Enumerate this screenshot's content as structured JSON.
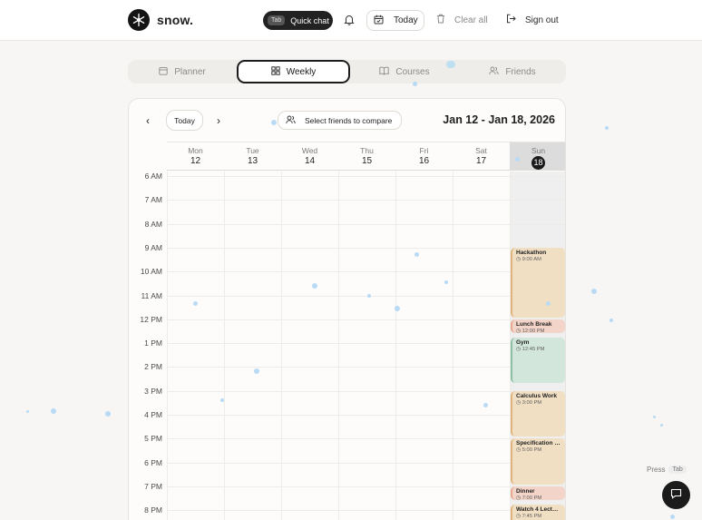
{
  "header": {
    "brand": "snow.",
    "quick_chat": {
      "kbd": "Tab",
      "label": "Quick chat"
    },
    "today_label": "Today",
    "clear_label": "Clear all",
    "signout_label": "Sign out"
  },
  "view_tabs": [
    {
      "label": "Planner",
      "icon": "calendar-icon",
      "active": false
    },
    {
      "label": "Weekly",
      "icon": "grid-icon",
      "active": true
    },
    {
      "label": "Courses",
      "icon": "book-icon",
      "active": false
    },
    {
      "label": "Friends",
      "icon": "users-icon",
      "active": false
    }
  ],
  "calendar": {
    "today_label": "Today",
    "friends_label": "Select friends to compare",
    "date_range": "Jan 12 - Jan 18, 2026",
    "days": [
      {
        "name": "Mon",
        "date": "12"
      },
      {
        "name": "Tue",
        "date": "13"
      },
      {
        "name": "Wed",
        "date": "14"
      },
      {
        "name": "Thu",
        "date": "15"
      },
      {
        "name": "Fri",
        "date": "16"
      },
      {
        "name": "Sat",
        "date": "17"
      },
      {
        "name": "Sun",
        "date": "18"
      }
    ],
    "hours": [
      "6 AM",
      "7 AM",
      "8 AM",
      "9 AM",
      "10 AM",
      "11 AM",
      "12 PM",
      "1 PM",
      "2 PM",
      "3 PM",
      "4 PM",
      "5 PM",
      "6 PM",
      "7 PM",
      "8 PM"
    ],
    "events": [
      {
        "title": "Hackathon",
        "time": "9:00 AM",
        "start": 9.0,
        "end": 12.0,
        "bg": "#f1dfc4",
        "border": "#e0b57b"
      },
      {
        "title": "Lunch Break",
        "time": "12:00 PM",
        "start": 12.0,
        "end": 12.65,
        "bg": "#f3d4c8",
        "border": "#e6a98f"
      },
      {
        "title": "Gym",
        "time": "12:45 PM",
        "start": 12.75,
        "end": 14.75,
        "bg": "#d2e6db",
        "border": "#8dc0a3"
      },
      {
        "title": "Calculus Work",
        "time": "3:00 PM",
        "start": 15.0,
        "end": 17.0,
        "bg": "#f1dfc4",
        "border": "#e0b57b"
      },
      {
        "title": "Specification D...",
        "time": "5:00 PM",
        "start": 17.0,
        "end": 19.0,
        "bg": "#f1dfc4",
        "border": "#e0b57b"
      },
      {
        "title": "Dinner",
        "time": "7:00 PM",
        "start": 19.0,
        "end": 19.65,
        "bg": "#f3d4c8",
        "border": "#e6a98f"
      },
      {
        "title": "Watch 4 Lectur...",
        "time": "7:45 PM",
        "start": 19.75,
        "end": 21.0,
        "bg": "#f1dfc4",
        "border": "#e0b57b"
      }
    ]
  },
  "footer": {
    "press": "Press",
    "tab": "Tab"
  }
}
